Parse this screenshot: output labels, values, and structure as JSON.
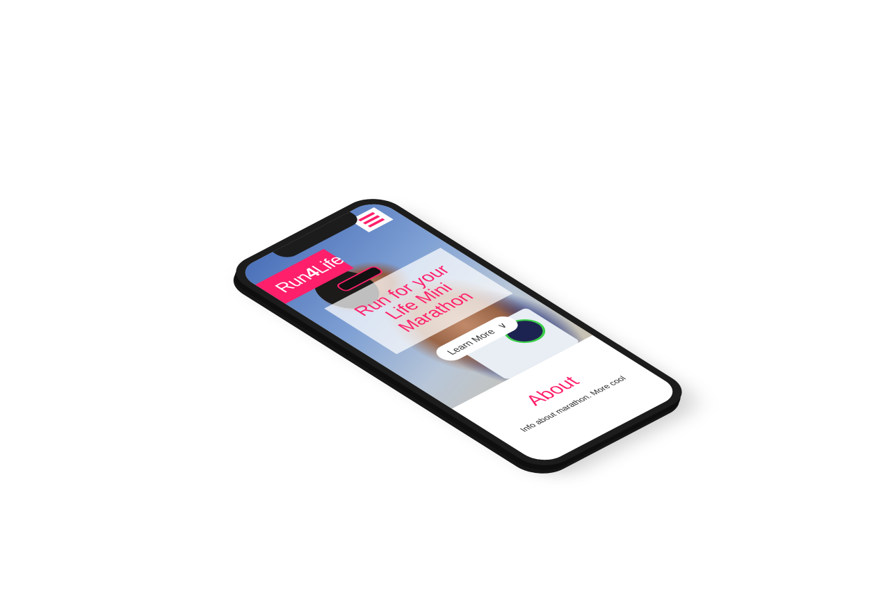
{
  "header": {
    "logo_prefix": "Run",
    "logo_number": "4",
    "logo_suffix": "Life"
  },
  "hero": {
    "title": "Run for your Life Mini Marathon",
    "cta_label": "Learn More",
    "cta_icon": "chevron-down-icon"
  },
  "about": {
    "heading": "About",
    "text": "Info about marathon. More cool"
  },
  "colors": {
    "accent": "#ff1f6b",
    "phone": "#1c1c1c"
  }
}
